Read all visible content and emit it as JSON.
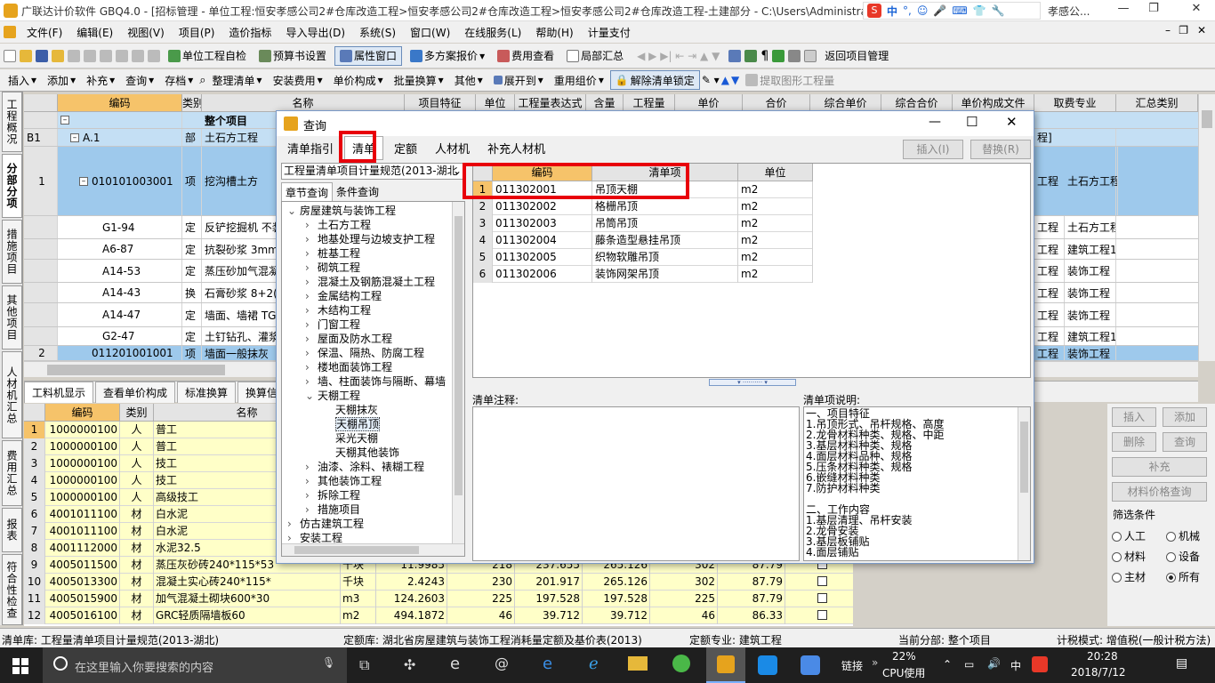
{
  "app": {
    "title": "广联达计价软件 GBQ4.0 - [招标管理 - 单位工程:恒安孝感公司2#仓库改造工程>恒安孝感公司2#仓库改造工程>恒安孝感公司2#仓库改造工程-土建部分 - C:\\Users\\Administrato",
    "title_tail": "孝感公...",
    "ime": "中",
    "win_min": "—",
    "win_restore": "❐",
    "win_close": "✕",
    "mdi_min": "–",
    "mdi_restore": "❐",
    "mdi_close": "✕"
  },
  "menu": [
    "文件(F)",
    "编辑(E)",
    "视图(V)",
    "项目(P)",
    "造价指标",
    "导入导出(D)",
    "系统(S)",
    "窗口(W)",
    "在线服务(L)",
    "帮助(H)",
    "计量支付"
  ],
  "toolbar1": {
    "items": [
      "单位工程自检",
      "预算书设置",
      "属性窗口",
      "多方案报价",
      "费用查看",
      "局部汇总"
    ],
    "back": "返回项目管理"
  },
  "toolbar2": {
    "items": [
      "插入",
      "添加",
      "补充",
      "查询",
      "存档",
      "整理清单",
      "安装费用",
      "单价构成",
      "批量换算",
      "其他",
      "展开到",
      "重用组价",
      "解除清单锁定",
      "提取图形工程量"
    ]
  },
  "sidetabs": [
    "工程概况",
    "分部分项",
    "措施项目",
    "其他项目",
    "人材机汇总",
    "费用汇总",
    "报表",
    "符合性检查"
  ],
  "main_grid": {
    "headers": [
      "编码",
      "类别",
      "名称",
      "项目特征",
      "单位",
      "工程量表达式",
      "含量",
      "工程量",
      "单价",
      "合价",
      "综合单价",
      "综合合价",
      "单价构成文件",
      "取费专业",
      "汇总类别"
    ],
    "rows": [
      {
        "num": "",
        "code": "",
        "type": "",
        "name": "整个项目",
        "fee": "",
        "unitfile": ""
      },
      {
        "num": "B1",
        "code": "A.1",
        "type": "部",
        "name": "土石方工程",
        "fee": "",
        "unitfile": "程]"
      },
      {
        "num": "1",
        "code": "010101003001",
        "type": "项",
        "name": "挖沟槽土方",
        "fee": "土石方工程",
        "unitfile": "工程"
      },
      {
        "num": "",
        "code": "G1-94",
        "type": "定",
        "name": "反铲挖掘机  不装车 三类土",
        "fee": "土石方工程",
        "unitfile": "工程"
      },
      {
        "num": "",
        "code": "A6-87",
        "type": "定",
        "name": "抗裂砂浆 3mm",
        "fee": "建筑工程12层",
        "unitfile": "工程"
      },
      {
        "num": "",
        "code": "A14-53",
        "type": "定",
        "name": "蒸压砂加气混凝土 薄抹灰 两遍4mm",
        "fee": "装饰工程",
        "unitfile": "工程"
      },
      {
        "num": "",
        "code": "A14-43",
        "type": "换",
        "name": "石膏砂浆 8+2(",
        "fee": "装饰工程",
        "unitfile": "工程"
      },
      {
        "num": "",
        "code": "A14-47",
        "type": "定",
        "name": "墙面、墙裙 TG 胶砂浆 砌块墙面",
        "fee": "装饰工程",
        "unitfile": "工程"
      },
      {
        "num": "",
        "code": "G2-47",
        "type": "定",
        "name": "土钉钻孔、灌浆",
        "fee": "建筑工程12层",
        "unitfile": "工程"
      },
      {
        "num": "2",
        "code": "011201001001",
        "type": "项",
        "name": "墙面一般抹灰",
        "fee": "装饰工程",
        "unitfile": "工程"
      }
    ]
  },
  "bottom_tabs": [
    "工料机显示",
    "查看单价构成",
    "标准换算",
    "换算信息"
  ],
  "sub_grid": {
    "headers": [
      "编码",
      "类别",
      "名称"
    ],
    "rows": [
      {
        "n": "1",
        "code": "1000000100",
        "type": "人",
        "name": "普工",
        "unit": "",
        "qty": "",
        "a": "",
        "b": "",
        "c": "",
        "d": "",
        "e": ""
      },
      {
        "n": "2",
        "code": "1000000100",
        "type": "人",
        "name": "普工",
        "unit": "",
        "qty": "",
        "a": "",
        "b": "",
        "c": "",
        "d": "",
        "e": ""
      },
      {
        "n": "3",
        "code": "1000000100",
        "type": "人",
        "name": "技工",
        "unit": "",
        "qty": "",
        "a": "",
        "b": "",
        "c": "",
        "d": "",
        "e": ""
      },
      {
        "n": "4",
        "code": "1000000100",
        "type": "人",
        "name": "技工",
        "unit": "",
        "qty": "",
        "a": "",
        "b": "",
        "c": "",
        "d": "",
        "e": ""
      },
      {
        "n": "5",
        "code": "1000000100",
        "type": "人",
        "name": "高级技工",
        "unit": "",
        "qty": "",
        "a": "",
        "b": "",
        "c": "",
        "d": "",
        "e": ""
      },
      {
        "n": "6",
        "code": "4001011100",
        "type": "材",
        "name": "白水泥",
        "unit": "",
        "qty": "",
        "a": "",
        "b": "",
        "c": "",
        "d": "",
        "e": ""
      },
      {
        "n": "7",
        "code": "4001011100",
        "type": "材",
        "name": "白水泥",
        "unit": "",
        "qty": "",
        "a": "",
        "b": "",
        "c": "",
        "d": "",
        "e": ""
      },
      {
        "n": "8",
        "code": "4001112000",
        "type": "材",
        "name": "水泥32.5",
        "unit": "",
        "qty": "",
        "a": "",
        "b": "",
        "c": "",
        "d": "",
        "e": ""
      },
      {
        "n": "9",
        "code": "4005011500",
        "type": "材",
        "name": "蒸压灰砂砖240*115*53",
        "unit": "千块",
        "qty": "11.9985",
        "a": "218",
        "b": "237.655",
        "c": "265.126",
        "d": "302",
        "e": "87.79"
      },
      {
        "n": "10",
        "code": "4005013300",
        "type": "材",
        "name": "混凝土实心砖240*115*",
        "unit": "千块",
        "qty": "2.4243",
        "a": "230",
        "b": "201.917",
        "c": "265.126",
        "d": "302",
        "e": "87.79"
      },
      {
        "n": "11",
        "code": "4005015900",
        "type": "材",
        "name": "加气混凝土砌块600*30",
        "unit": "m3",
        "qty": "124.2603",
        "a": "225",
        "b": "197.528",
        "c": "197.528",
        "d": "225",
        "e": "87.79"
      },
      {
        "n": "12",
        "code": "4005016100",
        "type": "材",
        "name": "GRC轻质隔墙板60",
        "unit": "m2",
        "qty": "494.1872",
        "a": "46",
        "b": "39.712",
        "c": "39.712",
        "d": "46",
        "e": "86.33"
      }
    ]
  },
  "right_panel": {
    "buttons": [
      "插入",
      "添加",
      "删除",
      "查询",
      "补充",
      "材料价格查询"
    ],
    "filter_title": "筛选条件",
    "radios": [
      "人工",
      "机械",
      "材料",
      "设备",
      "主材",
      "所有"
    ],
    "selected": "所有"
  },
  "status": {
    "list_lib": "清单库:  工程量清单项目计量规范(2013-湖北)",
    "quota_lib": "定额库:  湖北省房屋建筑与装饰工程消耗量定额及基价表(2013)",
    "quota_major": "定额专业:  建筑工程",
    "current": "当前分部:  整个项目",
    "tax": "计税模式:  增值税(一般计税方法)"
  },
  "taskbar": {
    "search": "在这里输入你要搜索的内容",
    "link": "链接",
    "cpu_pct": "22%",
    "cpu_label": "CPU使用",
    "lang": "中",
    "time": "20:28",
    "date": "2018/7/12"
  },
  "dialog": {
    "title": "查询",
    "tabs": [
      "清单指引",
      "清单",
      "定额",
      "人材机",
      "补充人材机"
    ],
    "active_tab": "清单",
    "insert": "插入(I)",
    "replace": "替换(R)",
    "spec": "工程量清单项目计量规范(2013-湖北",
    "subtabs": [
      "章节查询",
      "条件查询"
    ],
    "tree": [
      {
        "label": "房屋建筑与装饰工程",
        "level": 0,
        "exp": "⌄"
      },
      {
        "label": "土石方工程",
        "level": 1,
        "exp": "›"
      },
      {
        "label": "地基处理与边坡支护工程",
        "level": 1,
        "exp": "›"
      },
      {
        "label": "桩基工程",
        "level": 1,
        "exp": "›"
      },
      {
        "label": "砌筑工程",
        "level": 1,
        "exp": "›"
      },
      {
        "label": "混凝土及钢筋混凝土工程",
        "level": 1,
        "exp": "›"
      },
      {
        "label": "金属结构工程",
        "level": 1,
        "exp": "›"
      },
      {
        "label": "木结构工程",
        "level": 1,
        "exp": "›"
      },
      {
        "label": "门窗工程",
        "level": 1,
        "exp": "›"
      },
      {
        "label": "屋面及防水工程",
        "level": 1,
        "exp": "›"
      },
      {
        "label": "保温、隔热、防腐工程",
        "level": 1,
        "exp": "›"
      },
      {
        "label": "楼地面装饰工程",
        "level": 1,
        "exp": "›"
      },
      {
        "label": "墙、柱面装饰与隔断、幕墙",
        "level": 1,
        "exp": "›"
      },
      {
        "label": "天棚工程",
        "level": 1,
        "exp": "⌄"
      },
      {
        "label": "天棚抹灰",
        "level": 2,
        "exp": ""
      },
      {
        "label": "天棚吊顶",
        "level": 2,
        "exp": ""
      },
      {
        "label": "采光天棚",
        "level": 2,
        "exp": ""
      },
      {
        "label": "天棚其他装饰",
        "level": 2,
        "exp": ""
      },
      {
        "label": "油漆、涂料、裱糊工程",
        "level": 1,
        "exp": "›"
      },
      {
        "label": "其他装饰工程",
        "level": 1,
        "exp": "›"
      },
      {
        "label": "拆除工程",
        "level": 1,
        "exp": "›"
      },
      {
        "label": "措施项目",
        "level": 1,
        "exp": "›"
      },
      {
        "label": "仿古建筑工程",
        "level": 0,
        "exp": "›"
      },
      {
        "label": "安装工程",
        "level": 0,
        "exp": "›"
      }
    ],
    "selected_node": "天棚吊顶",
    "list_headers": [
      "编码",
      "清单项",
      "单位"
    ],
    "list_rows": [
      {
        "n": "1",
        "code": "011302001",
        "name": "吊顶天棚",
        "unit": "m2"
      },
      {
        "n": "2",
        "code": "011302002",
        "name": "格栅吊顶",
        "unit": "m2"
      },
      {
        "n": "3",
        "code": "011302003",
        "name": "吊筒吊顶",
        "unit": "m2"
      },
      {
        "n": "4",
        "code": "011302004",
        "name": "藤条造型悬挂吊顶",
        "unit": "m2"
      },
      {
        "n": "5",
        "code": "011302005",
        "name": "织物软雕吊顶",
        "unit": "m2"
      },
      {
        "n": "6",
        "code": "011302006",
        "name": "装饰网架吊顶",
        "unit": "m2"
      }
    ],
    "note_label": "清单注释:",
    "desc_label": "清单项说明:",
    "desc_lines": [
      "一、项目特征",
      "1.吊顶形式、吊杆规格、高度",
      "2.龙骨材料种类、规格、中距",
      "3.基层材料种类、规格",
      "4.面层材料品种、规格",
      "5.压条材料种类、规格",
      "6.嵌缝材料种类",
      "7.防护材料种类",
      "",
      "二、工作内容",
      "1.基层清理、吊杆安装",
      "2.龙骨安装",
      "3.基层板铺贴",
      "4.面层铺贴"
    ]
  },
  "colors": {
    "selection": "#9ec9ec",
    "header_sel": "#f6c36a",
    "yellow": "#ffffc8",
    "red": "#e8000a"
  }
}
